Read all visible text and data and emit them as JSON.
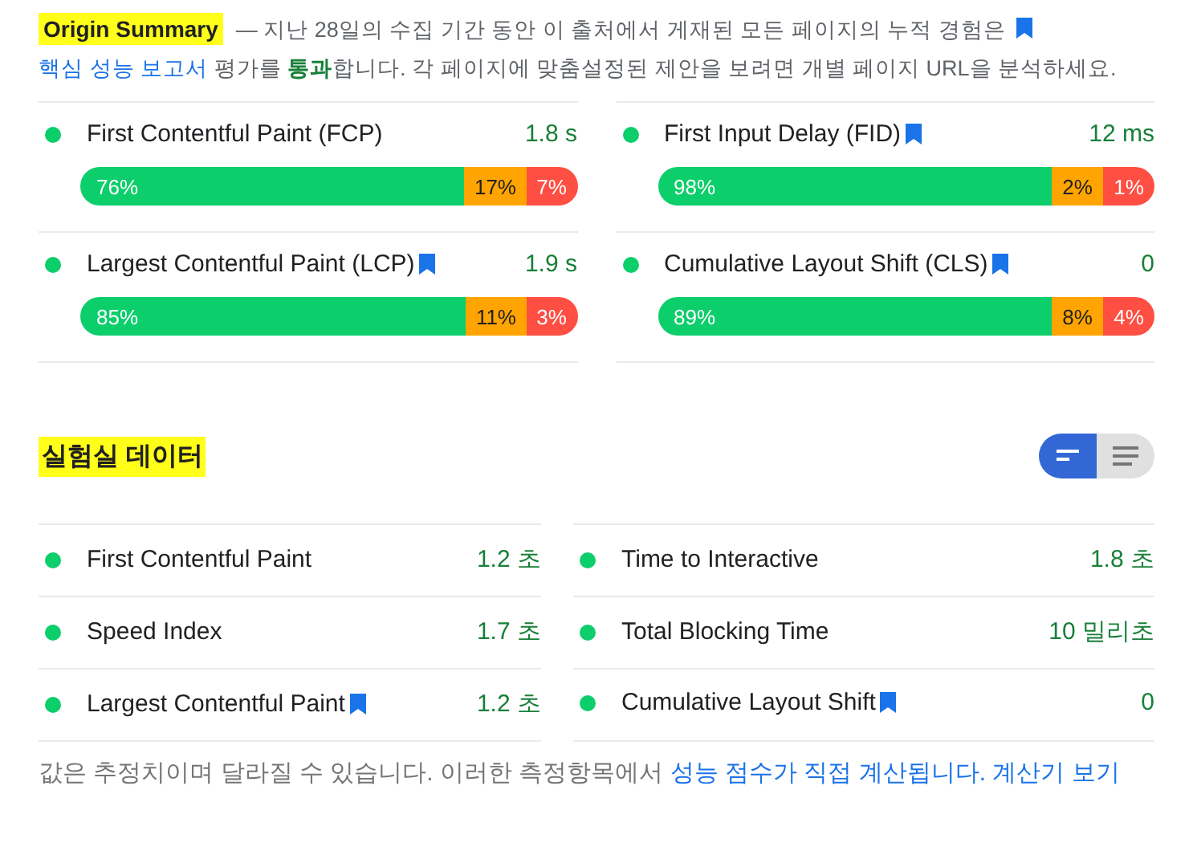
{
  "origin_summary": {
    "title": "Origin Summary",
    "text_before": "— 지난 28일의 수집 기간 동안 이 출처에서 게재된 모든 페이지의 누적 경험은",
    "link": "핵심 성능 보고서",
    "text_middle": "평가를",
    "result": "통과",
    "text_after": "합니다. 각 페이지에 맞춤설정된 제안을 보려면 개별 페이지 URL을 분석하세요."
  },
  "field_metrics": [
    {
      "name": "First Contentful Paint (FCP)",
      "bookmark": false,
      "value": "1.8 s",
      "segments": [
        {
          "kind": "good",
          "label": "76%"
        },
        {
          "kind": "average",
          "label": "17%"
        },
        {
          "kind": "poor",
          "label": "7%"
        }
      ]
    },
    {
      "name": "First Input Delay (FID)",
      "bookmark": true,
      "value": "12 ms",
      "segments": [
        {
          "kind": "good",
          "label": "98%"
        },
        {
          "kind": "average",
          "label": "2%"
        },
        {
          "kind": "poor",
          "label": "1%"
        }
      ]
    },
    {
      "name": "Largest Contentful Paint (LCP)",
      "bookmark": true,
      "value": "1.9 s",
      "segments": [
        {
          "kind": "good",
          "label": "85%"
        },
        {
          "kind": "average",
          "label": "11%"
        },
        {
          "kind": "poor",
          "label": "3%"
        }
      ]
    },
    {
      "name": "Cumulative Layout Shift (CLS)",
      "bookmark": true,
      "value": "0",
      "segments": [
        {
          "kind": "good",
          "label": "89%"
        },
        {
          "kind": "average",
          "label": "8%"
        },
        {
          "kind": "poor",
          "label": "4%"
        }
      ]
    }
  ],
  "lab_data": {
    "title": "실험실 데이터",
    "view_toggle": [
      {
        "kind": "summary",
        "selected": true
      },
      {
        "kind": "list",
        "selected": false
      }
    ],
    "metrics": [
      {
        "name": "First Contentful Paint",
        "bookmark": false,
        "value": "1.2 초"
      },
      {
        "name": "Time to Interactive",
        "bookmark": false,
        "value": "1.8 초"
      },
      {
        "name": "Speed Index",
        "bookmark": false,
        "value": "1.7 초"
      },
      {
        "name": "Total Blocking Time",
        "bookmark": false,
        "value": "10 밀리초"
      },
      {
        "name": "Largest Contentful Paint",
        "bookmark": true,
        "value": "1.2 초"
      },
      {
        "name": "Cumulative Layout Shift",
        "bookmark": true,
        "value": "0"
      }
    ]
  },
  "footer": {
    "text": "값은 추정치이며 달라질 수 있습니다. 이러한 측정항목에서",
    "link": "성능 점수가 직접 계산됩니다.",
    "link2": "계산기 보기"
  }
}
